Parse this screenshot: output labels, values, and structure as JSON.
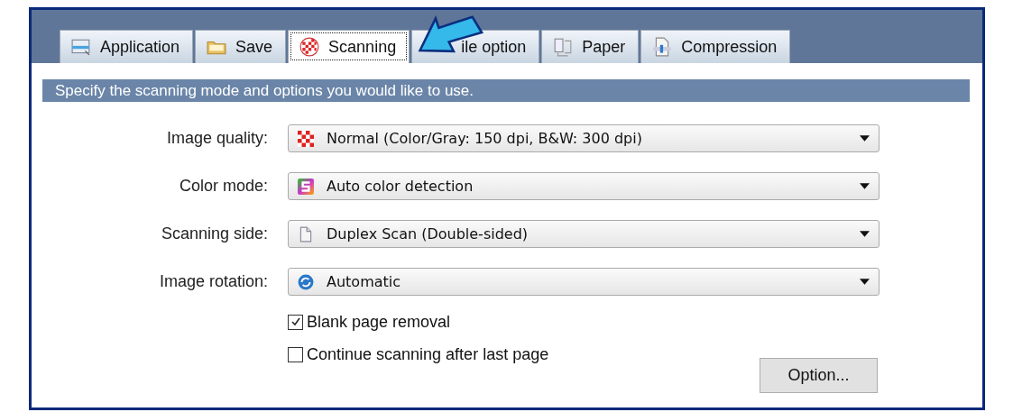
{
  "tabs": [
    {
      "label": "Application",
      "selected": false
    },
    {
      "label": "Save",
      "selected": false
    },
    {
      "label": "Scanning",
      "selected": true
    },
    {
      "label": "ile option",
      "selected": false
    },
    {
      "label": "Paper",
      "selected": false
    },
    {
      "label": "Compression",
      "selected": false
    }
  ],
  "description": "Specify the scanning mode and options you would like to use.",
  "settings": [
    {
      "label": "Image quality:",
      "value": "Normal (Color/Gray: 150 dpi, B&W: 300 dpi)"
    },
    {
      "label": "Color mode:",
      "value": "Auto color detection"
    },
    {
      "label": "Scanning side:",
      "value": "Duplex Scan (Double-sided)"
    },
    {
      "label": "Image rotation:",
      "value": "Automatic"
    }
  ],
  "checkboxes": [
    {
      "label": "Blank page removal",
      "checked": true
    },
    {
      "label": "Continue scanning after last page",
      "checked": false
    }
  ],
  "option_button": "Option..."
}
